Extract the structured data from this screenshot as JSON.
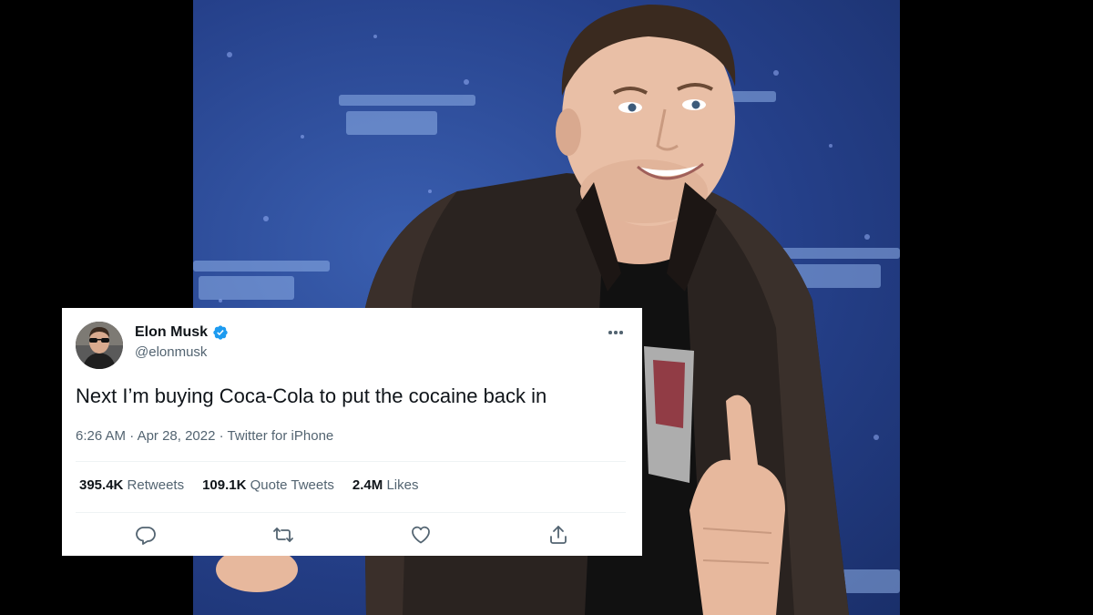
{
  "tweet": {
    "author_name": "Elon Musk",
    "handle": "@elonmusk",
    "verified": true,
    "text": "Next I’m buying Coca-Cola to put the cocaine back in",
    "time": "6:26 AM",
    "separator": " · ",
    "date": "Apr 28, 2022",
    "source": "Twitter for iPhone",
    "stats": {
      "retweets_count": "395.4K",
      "retweets_label": "Retweets",
      "quotes_count": "109.1K",
      "quotes_label": "Quote Tweets",
      "likes_count": "2.4M",
      "likes_label": "Likes"
    },
    "icons": {
      "more": "more-horizontal-icon",
      "reply": "reply-icon",
      "retweet": "retweet-icon",
      "like": "heart-icon",
      "share": "share-icon",
      "verified": "verified-badge-icon"
    }
  },
  "colors": {
    "verified_blue": "#1d9bf0",
    "text_primary": "#0f1419",
    "text_secondary": "#536471",
    "photo_backdrop": "#2a4a9a"
  }
}
